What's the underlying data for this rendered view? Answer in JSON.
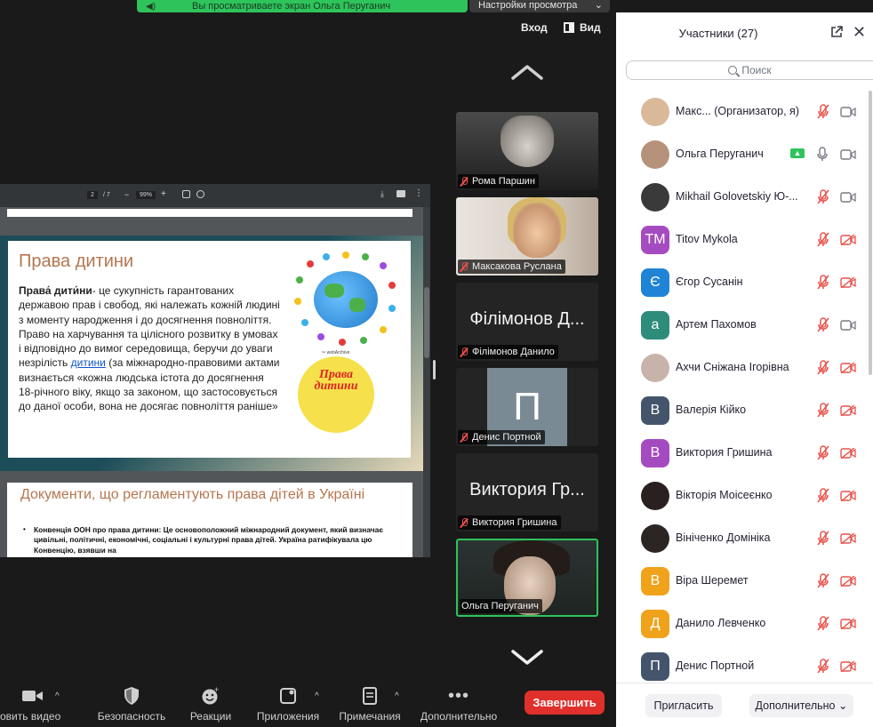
{
  "banner": {
    "text": "Вы просматриваете экран Ольга Перуганич",
    "view_settings": "Настройки просмотра"
  },
  "top_controls": {
    "exit": "Вход",
    "view": "Вид"
  },
  "pdf": {
    "page_current": "2",
    "page_total": "/ 7",
    "zoom": "99%",
    "slide1": {
      "title": "Права дитини",
      "lead_bold": "Права́ дити́ни",
      "body_1": "-  це сукупність гарантованих державою прав і свобод, які належать кожній людині з моменту народження і до досягнення повноліття. Право на харчування та цілісного розвитку в умовах і відповідно до вимог середовища, беручи до уваги незрілість ",
      "link": "дитини",
      "body_2": " (за міжнародно-правовими актами визнається «кожна людська істота до досягнення 18-річного віку, якщо за законом, що застосовується до даної особи, вона не досягає повноліття раніше»",
      "logo_text": "Права дитини",
      "logo_small": "✂ webArchive"
    },
    "slide2": {
      "title": "Документи, що регламентують права дітей в Україні",
      "bullet": "Конвенція ООН про права дитини: Це основоположний міжнародний документ, який визначає цивільні, політичні, економічні, соціальні і культурні права дітей. Україна ратифікувала цю Конвенцію, взявши на"
    }
  },
  "tiles": [
    {
      "name": "Рома Паршин",
      "kind": "camera"
    },
    {
      "name": "Максакова Руслана",
      "kind": "camera"
    },
    {
      "name": "Філімонов Данило",
      "big": "Філімонов Д...",
      "kind": "name"
    },
    {
      "name": "Денис Портной",
      "letter": "П",
      "kind": "letter"
    },
    {
      "name": "Виктория Гришина",
      "big": "Виктория Гр...",
      "kind": "name"
    },
    {
      "name": "Ольга Перуганич",
      "kind": "camera",
      "active": true
    }
  ],
  "toolbar": {
    "video": "овить видео",
    "security": "Безопасность",
    "reactions": "Реакции",
    "apps": "Приложения",
    "notes": "Примечания",
    "more": "Дополнительно",
    "end": "Завершить"
  },
  "panel": {
    "title": "Участники (27)",
    "search_placeholder": "Поиск",
    "invite": "Пригласить",
    "more": "Дополнительно",
    "participants": [
      {
        "name": "Макс...  (Организатор, я)",
        "avatar": "photo",
        "color": "#d9b99a",
        "mic": "off",
        "cam": "on"
      },
      {
        "name": "Ольга Перуганич",
        "avatar": "photo",
        "color": "#b7927a",
        "mic": "on",
        "cam": "on",
        "sharing": true
      },
      {
        "name": "Mikhail Golovetskiy Ю-...",
        "avatar": "photo",
        "color": "#3a3a3a",
        "mic": "off",
        "cam": "on"
      },
      {
        "name": "Titov Mykola",
        "avatar": "ТМ",
        "color": "#a54bc1",
        "mic": "off",
        "cam": "off"
      },
      {
        "name": "Єгор Сусанін",
        "avatar": "Є",
        "color": "#1f84d6",
        "mic": "off",
        "cam": "off"
      },
      {
        "name": "Артем Пахомов",
        "avatar": "а",
        "color": "#2e8c7a",
        "mic": "off",
        "cam": "on"
      },
      {
        "name": "Ахчи Сніжана Ігорівна",
        "avatar": "photo",
        "color": "#c7b3aa",
        "mic": "off",
        "cam": "off"
      },
      {
        "name": "Валерія Кійко",
        "avatar": "В",
        "color": "#44556b",
        "mic": "off",
        "cam": "off"
      },
      {
        "name": "Виктория Гришина",
        "avatar": "В",
        "color": "#a54bc1",
        "mic": "off",
        "cam": "off"
      },
      {
        "name": "Вікторія Моісеєнко",
        "avatar": "photo",
        "color": "#2a2020",
        "mic": "off",
        "cam": "off"
      },
      {
        "name": "Вініченко Домініка",
        "avatar": "photo",
        "color": "#2b2623",
        "mic": "off",
        "cam": "off"
      },
      {
        "name": "Віра Шеремет",
        "avatar": "В",
        "color": "#f0a21b",
        "mic": "off",
        "cam": "off"
      },
      {
        "name": "Данило Левченко",
        "avatar": "Д",
        "color": "#f0a21b",
        "mic": "off",
        "cam": "off"
      },
      {
        "name": "Денис Портной",
        "avatar": "П",
        "color": "#44556b",
        "mic": "off",
        "cam": "off"
      }
    ]
  }
}
